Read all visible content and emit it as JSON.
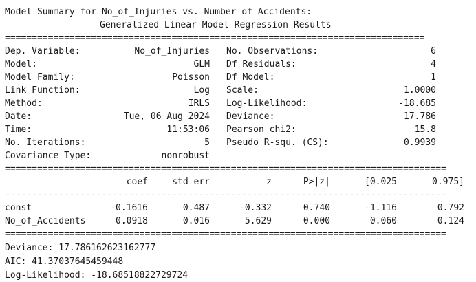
{
  "header_line": "Model Summary for No_of_Injuries vs. Number of Accidents:",
  "title": "Generalized Linear Model Regression Results",
  "rule_double": "==============================================================================",
  "rule_double_long": "==================================================================================",
  "rule_single_long": "----------------------------------------------------------------------------------",
  "summary": {
    "left": [
      {
        "label": "Dep. Variable:",
        "value": "No_of_Injuries"
      },
      {
        "label": "Model:",
        "value": "GLM"
      },
      {
        "label": "Model Family:",
        "value": "Poisson"
      },
      {
        "label": "Link Function:",
        "value": "Log"
      },
      {
        "label": "Method:",
        "value": "IRLS"
      },
      {
        "label": "Date:",
        "value": "Tue, 06 Aug 2024"
      },
      {
        "label": "Time:",
        "value": "11:53:06"
      },
      {
        "label": "No. Iterations:",
        "value": "5"
      },
      {
        "label": "Covariance Type:",
        "value": "nonrobust"
      }
    ],
    "right": [
      {
        "label": "No. Observations:",
        "value": "6"
      },
      {
        "label": "Df Residuals:",
        "value": "4"
      },
      {
        "label": "Df Model:",
        "value": "1"
      },
      {
        "label": "Scale:",
        "value": "1.0000"
      },
      {
        "label": "Log-Likelihood:",
        "value": "-18.685"
      },
      {
        "label": "Deviance:",
        "value": "17.786"
      },
      {
        "label": "Pearson chi2:",
        "value": "15.8"
      },
      {
        "label": "Pseudo R-squ. (CS):",
        "value": "0.9939"
      }
    ]
  },
  "coef_table": {
    "headers": [
      "coef",
      "std err",
      "z",
      "P>|z|",
      "[0.025",
      "0.975]"
    ],
    "rows": [
      {
        "name": "const",
        "values": [
          "-0.1616",
          "0.487",
          "-0.332",
          "0.740",
          "-1.116",
          "0.792"
        ]
      },
      {
        "name": "No_of_Accidents",
        "values": [
          "0.0918",
          "0.016",
          "5.629",
          "0.000",
          "0.060",
          "0.124"
        ]
      }
    ]
  },
  "footer": [
    "Deviance: 17.786162623162777",
    "AIC: 41.37037645459448",
    "Log-Likelihood: -18.68518822729724"
  ]
}
